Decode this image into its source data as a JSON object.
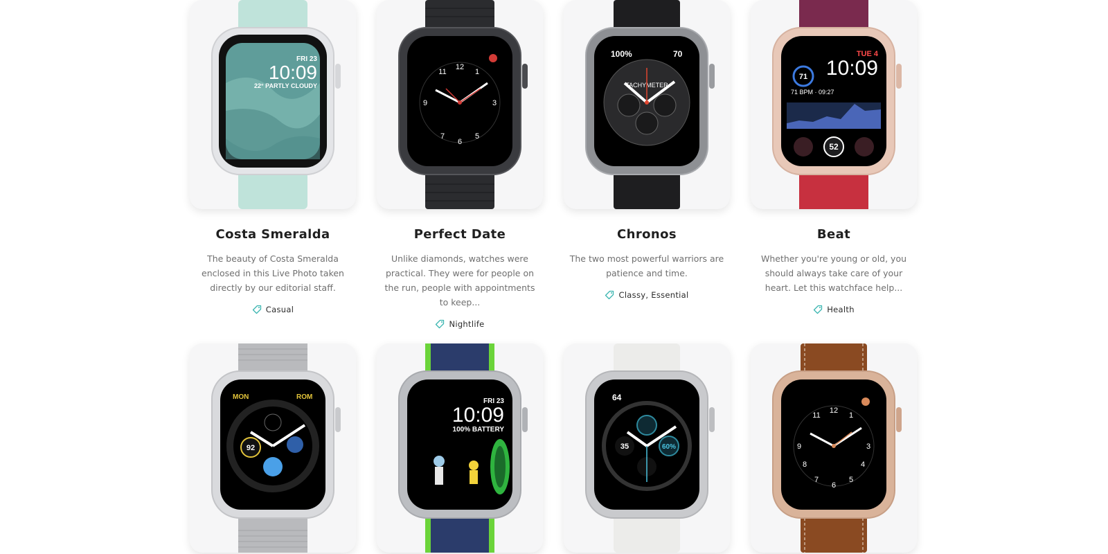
{
  "cards": [
    {
      "title": "Costa Smeralda",
      "description": "The beauty of Costa Smeralda enclosed in this Live Photo taken directly by our editorial staff.",
      "tag": "Casual",
      "band_color": "#bfe3da",
      "case_color": "#e6e7ea",
      "face": {
        "line1": "FRI 23",
        "line2": "10:09",
        "line3": "22° PARTLY CLOUDY"
      }
    },
    {
      "title": "Perfect Date",
      "description": "Unlike diamonds, watches were practical. They were for people on the run, people with appointments to keep...",
      "tag": "Nightlife",
      "band_color": "#2b2c2f",
      "case_color": "#3a3b3f",
      "face": {
        "line1": "",
        "line2": "",
        "line3": ""
      }
    },
    {
      "title": "Chronos",
      "description": "The two most powerful warriors are patience and time.",
      "tag": "Classy, Essential",
      "band_color": "#1e1e20",
      "case_color": "#8e9094",
      "face": {
        "line1": "100%",
        "line2": "TACHYMETER",
        "line3": "70"
      }
    },
    {
      "title": "Beat",
      "description": "Whether you're young or old, you should always take care of your heart. Let this watchface help...",
      "tag": "Health",
      "band_color": "#c7303f",
      "case_color": "#e8c8b8",
      "face": {
        "line1": "TUE 4",
        "line2": "10:09",
        "line3": "71 BPM · 09:27"
      }
    },
    {
      "title": "",
      "description": "",
      "tag": "",
      "band_color": "#b9babd",
      "case_color": "#d9dadd",
      "face": {
        "line1": "MON",
        "line2": "92",
        "line3": "ROM"
      }
    },
    {
      "title": "",
      "description": "",
      "tag": "",
      "band_color": "#2b3c6b",
      "case_color": "#bcbec2",
      "face": {
        "line1": "FRI 23",
        "line2": "10:09",
        "line3": "100% BATTERY"
      }
    },
    {
      "title": "",
      "description": "",
      "tag": "",
      "band_color": "#ececea",
      "case_color": "#c9cacd",
      "face": {
        "line1": "64",
        "line2": "35",
        "line3": "60%"
      }
    },
    {
      "title": "",
      "description": "",
      "tag": "",
      "band_color": "#8a4a22",
      "case_color": "#d9b39a",
      "face": {
        "line1": "",
        "line2": "",
        "line3": ""
      }
    }
  ],
  "colors": {
    "tag_icon": "#3ab5b0",
    "title": "#1f1f1f",
    "description": "#6f6f6f"
  },
  "icons": {
    "tag": "tag-icon"
  }
}
